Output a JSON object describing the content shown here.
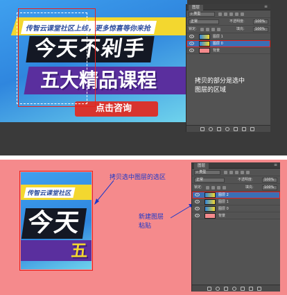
{
  "colors": {
    "pink": "#f58a8c",
    "panel": "#535353",
    "selected_row": "#3b6fb5",
    "red_outline": "#e8211d",
    "annotation_blue": "#1b38c9"
  },
  "top": {
    "banner": {
      "ribbon": "传智云课堂社区上线，更多惊喜等你来抢",
      "headline": "今天不剁手",
      "subheadline": "五大精品课程",
      "cta": "点击咨询"
    },
    "layers_panel": {
      "tab": "图层",
      "kind_filter": "类型",
      "blend_mode": "正常",
      "opacity_label": "不透明度:",
      "opacity_value": "100%",
      "lock_label": "锁定:",
      "fill_label": "填充:",
      "fill_value": "100%",
      "layers": [
        {
          "name": "图层 1",
          "selected": false,
          "thumb": "image"
        },
        {
          "name": "图层 0",
          "selected": true,
          "thumb": "image"
        },
        {
          "name": "背景",
          "selected": false,
          "thumb": "pink"
        }
      ],
      "annotation": [
        "拷贝的部分是选中",
        "图层的区域"
      ]
    }
  },
  "bottom": {
    "banner": {
      "ribbon": "传智云课堂社区",
      "headline": "今天",
      "subheadline": "五"
    },
    "annotation_selection": "拷贝选中图层的选区",
    "annotation_new_layer": [
      "新建图层",
      "粘贴"
    ],
    "layers_panel": {
      "tab": "图层",
      "kind_filter": "类型",
      "blend_mode": "正常",
      "opacity_label": "不透明度:",
      "opacity_value": "100%",
      "lock_label": "锁定:",
      "fill_label": "填充:",
      "fill_value": "100%",
      "layers": [
        {
          "name": "图层 2",
          "selected": true,
          "thumb": "image"
        },
        {
          "name": "图层 1",
          "selected": false,
          "thumb": "image"
        },
        {
          "name": "图层 0",
          "selected": false,
          "thumb": "image"
        },
        {
          "name": "背景",
          "selected": false,
          "thumb": "pink"
        }
      ]
    }
  }
}
